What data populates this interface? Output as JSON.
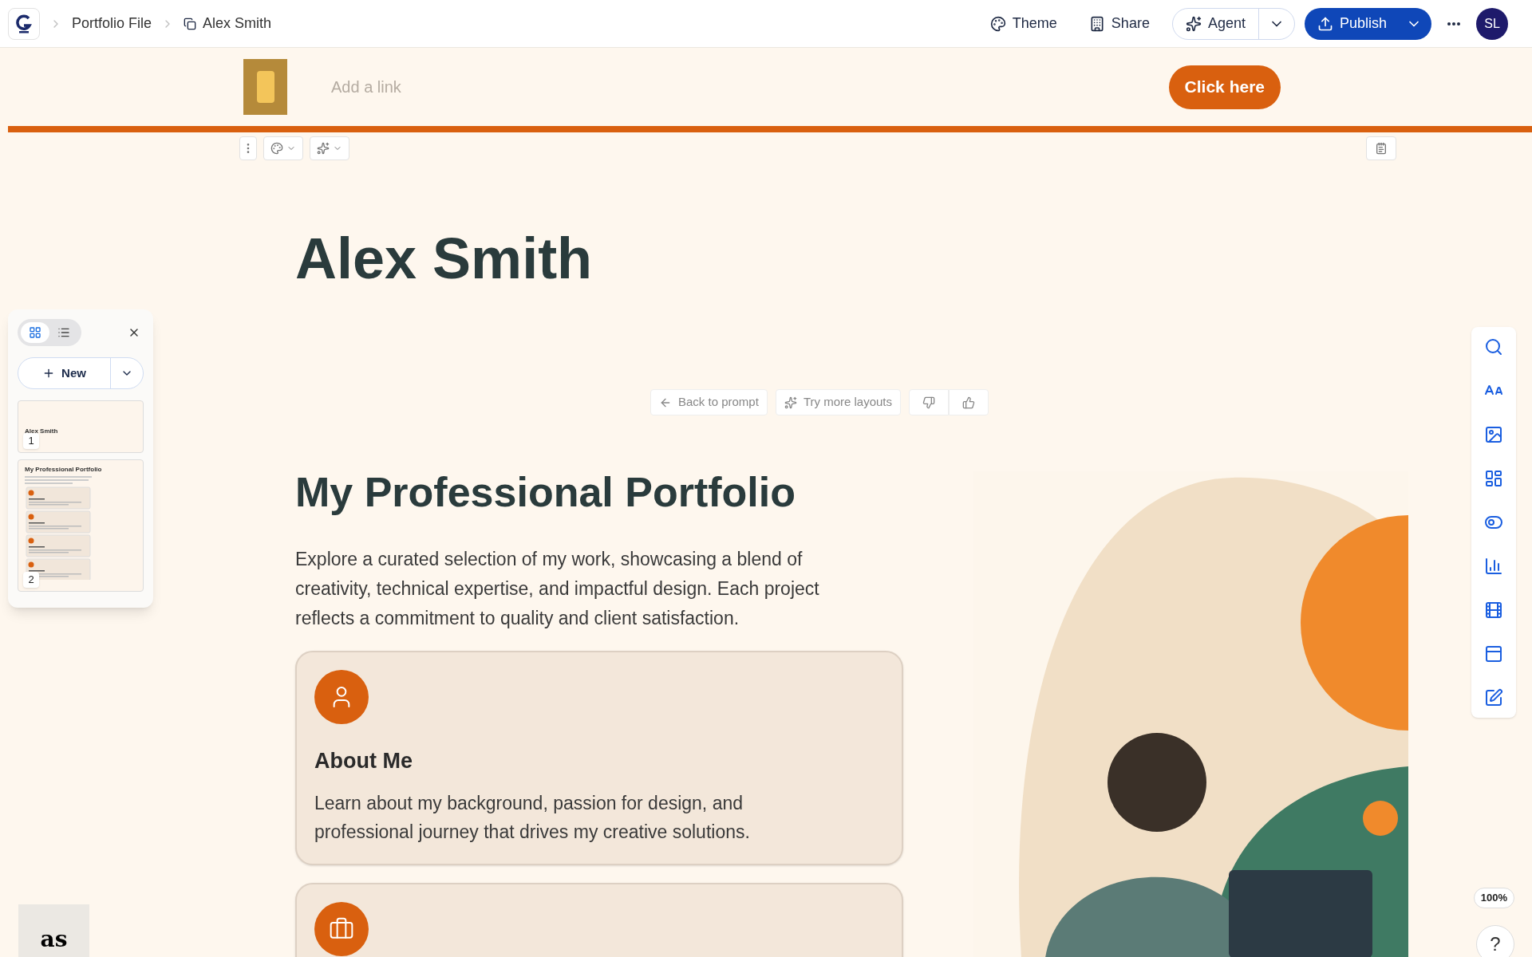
{
  "topbar": {
    "breadcrumbs": [
      "Portfolio File",
      "Alex Smith"
    ],
    "actions": [
      {
        "kind": "theme",
        "label": "Theme"
      },
      {
        "kind": "share",
        "label": "Share"
      }
    ],
    "agent": "Agent",
    "publish": "Publish",
    "avatar": "SL"
  },
  "banner": {
    "link_placeholder": "Add a link",
    "button": "Click here"
  },
  "title": "Alex Smith",
  "sidebar": {
    "views": [
      {
        "kind": "cards",
        "selected": true
      },
      {
        "kind": "list",
        "selected": false
      }
    ],
    "new_button": "New",
    "slides": [
      {
        "number": "1",
        "title": "Alex Smith",
        "kind": "title"
      },
      {
        "number": "2",
        "title": "My Professional Portfolio",
        "kind": "cards"
      }
    ]
  },
  "feedback": {
    "back": "Back to prompt",
    "more": "Try more layouts"
  },
  "section": {
    "heading": "My Professional Portfolio",
    "intro": "Explore a curated selection of my work, showcasing a blend of creativity, technical expertise, and impactful design. Each project reflects a commitment to quality and client satisfaction.",
    "cards": [
      {
        "kind": "person",
        "title": "About Me",
        "text": "Learn about my background, passion for design, and professional journey that drives my creative solutions."
      },
      {
        "kind": "briefcase"
      }
    ]
  },
  "logo": "as",
  "zoom": "100%",
  "help": "?"
}
